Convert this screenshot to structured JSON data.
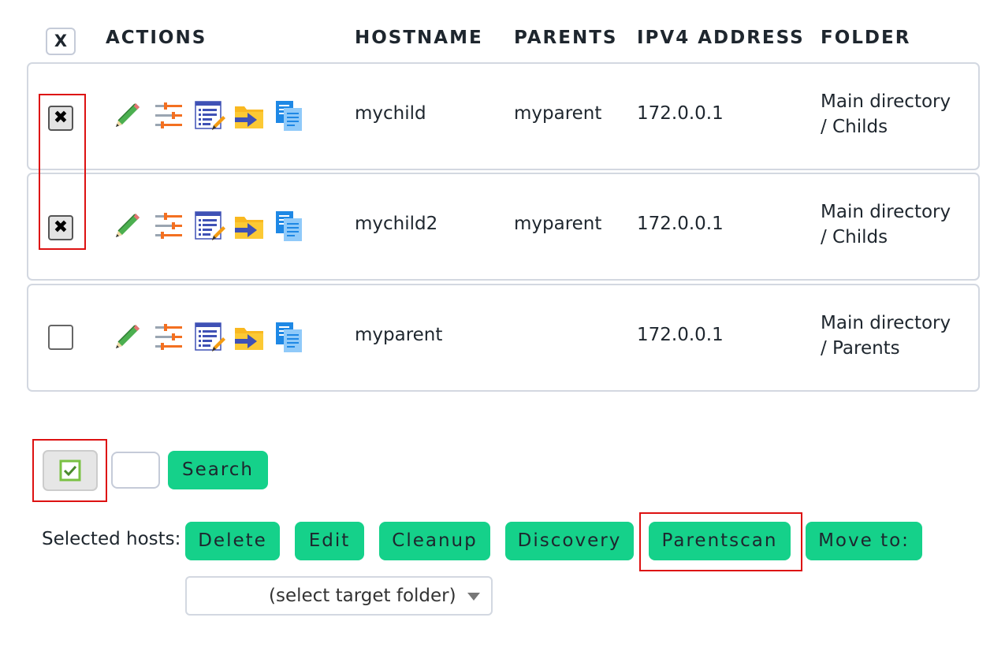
{
  "table": {
    "toggle_all_label": "X",
    "headers": {
      "actions": "ACTIONS",
      "hostname": "HOSTNAME",
      "parents": "PARENTS",
      "ipv4": "IPV4 ADDRESS",
      "folder": "FOLDER"
    },
    "rows": [
      {
        "checked": true,
        "check_glyph": "✖",
        "hostname": "mychild",
        "parents": "myparent",
        "ipv4": "172.0.0.1",
        "folder_line1": "Main directory",
        "folder_line2": "/ Childs"
      },
      {
        "checked": true,
        "check_glyph": "✖",
        "hostname": "mychild2",
        "parents": "myparent",
        "ipv4": "172.0.0.1",
        "folder_line1": "Main directory",
        "folder_line2": "/ Childs"
      },
      {
        "checked": false,
        "check_glyph": "",
        "hostname": "myparent",
        "parents": "",
        "ipv4": "172.0.0.1",
        "folder_line1": "Main directory",
        "folder_line2": "/ Parents"
      }
    ],
    "action_icons": [
      "edit-pencil-icon",
      "parameters-sliders-icon",
      "rules-list-icon",
      "move-folder-icon",
      "clone-pages-icon"
    ]
  },
  "search": {
    "button_label": "Search",
    "input_value": ""
  },
  "bulk": {
    "label": "Selected hosts:",
    "buttons": {
      "delete": "Delete",
      "edit": "Edit",
      "cleanup": "Cleanup",
      "discovery": "Discovery",
      "parentscan": "Parentscan",
      "move_to": "Move to:"
    },
    "target_folder_placeholder": "(select target folder)"
  },
  "colors": {
    "button_green": "#15d18a",
    "highlight_red": "#dd1111",
    "checkbox_green": "#7ac143"
  }
}
